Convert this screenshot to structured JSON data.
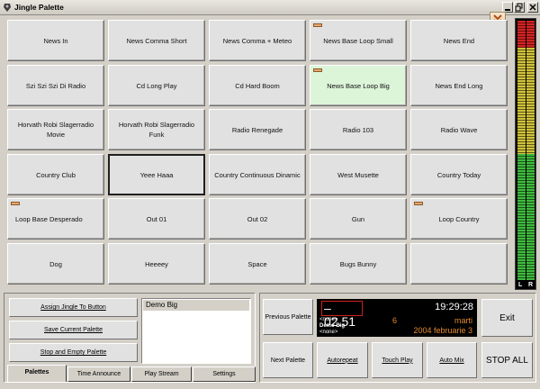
{
  "window": {
    "title": "Jingle Palette"
  },
  "buttons": [
    {
      "label": "News In",
      "flag": false,
      "state": "normal"
    },
    {
      "label": "News Comma Short",
      "flag": false,
      "state": "normal"
    },
    {
      "label": "News Comma + Meteo",
      "flag": false,
      "state": "normal"
    },
    {
      "label": "News Base Loop Small",
      "flag": true,
      "state": "normal"
    },
    {
      "label": "News End",
      "flag": false,
      "state": "normal"
    },
    {
      "label": "Szi Szi Szi Di Radio",
      "flag": false,
      "state": "normal"
    },
    {
      "label": "Cd Long Play",
      "flag": false,
      "state": "normal"
    },
    {
      "label": "Cd Hard Boom",
      "flag": false,
      "state": "normal"
    },
    {
      "label": "News Base Loop Big",
      "flag": true,
      "state": "playing"
    },
    {
      "label": "News End Long",
      "flag": false,
      "state": "normal"
    },
    {
      "label": "Horvath Robi Slagerradio Movie",
      "flag": false,
      "state": "normal"
    },
    {
      "label": "Horvath Robi Slagerradio Funk",
      "flag": false,
      "state": "normal"
    },
    {
      "label": "Radio Renegade",
      "flag": false,
      "state": "normal"
    },
    {
      "label": "Radio 103",
      "flag": false,
      "state": "normal"
    },
    {
      "label": "Radio Wave",
      "flag": false,
      "state": "normal"
    },
    {
      "label": "Country Club",
      "flag": false,
      "state": "normal"
    },
    {
      "label": "Yeee Haaa",
      "flag": false,
      "state": "selected"
    },
    {
      "label": "Country Continuous Dinamic",
      "flag": false,
      "state": "normal"
    },
    {
      "label": "West Musette",
      "flag": false,
      "state": "normal"
    },
    {
      "label": "Country Today",
      "flag": false,
      "state": "normal"
    },
    {
      "label": "Loop Base Desperado",
      "flag": true,
      "state": "normal"
    },
    {
      "label": "Out 01",
      "flag": false,
      "state": "normal"
    },
    {
      "label": "Out 02",
      "flag": false,
      "state": "normal"
    },
    {
      "label": "Gun",
      "flag": false,
      "state": "normal"
    },
    {
      "label": "Loop Country",
      "flag": true,
      "state": "normal"
    },
    {
      "label": "Dog",
      "flag": false,
      "state": "normal"
    },
    {
      "label": "Heeeey",
      "flag": false,
      "state": "normal"
    },
    {
      "label": "Space",
      "flag": false,
      "state": "normal"
    },
    {
      "label": "Bugs Bunny",
      "flag": false,
      "state": "normal"
    },
    {
      "label": "",
      "flag": false,
      "state": "normal"
    }
  ],
  "vu": {
    "left_label": "L",
    "right_label": "R"
  },
  "left_panel": {
    "assign": "Assign Jingle To Button",
    "save": "Save Current Palette",
    "stop_empty": "Stop and Empty Palette",
    "palettes": [
      "Demo Big"
    ]
  },
  "tabs": [
    "Palettes",
    "Time Announce",
    "Play Stream",
    "Settings"
  ],
  "player": {
    "time": "–02.51",
    "clock": "19:29:28",
    "count": "6",
    "day": "marti",
    "date": "2004 februarie 3",
    "line1": "<none>",
    "line2": "Demo Big",
    "line3": "<none>"
  },
  "controls": {
    "prev": "Previous Palette",
    "next": "Next Palette",
    "autorepeat": "Autorepeat",
    "touch_play": "Touch Play",
    "auto_mix": "Auto Mix",
    "exit": "Exit",
    "stop_all": "STOP ALL"
  },
  "colors": {
    "playing": "#dcf5d9",
    "flag": "#e8a56c",
    "display_accent": "#e38a2e"
  }
}
